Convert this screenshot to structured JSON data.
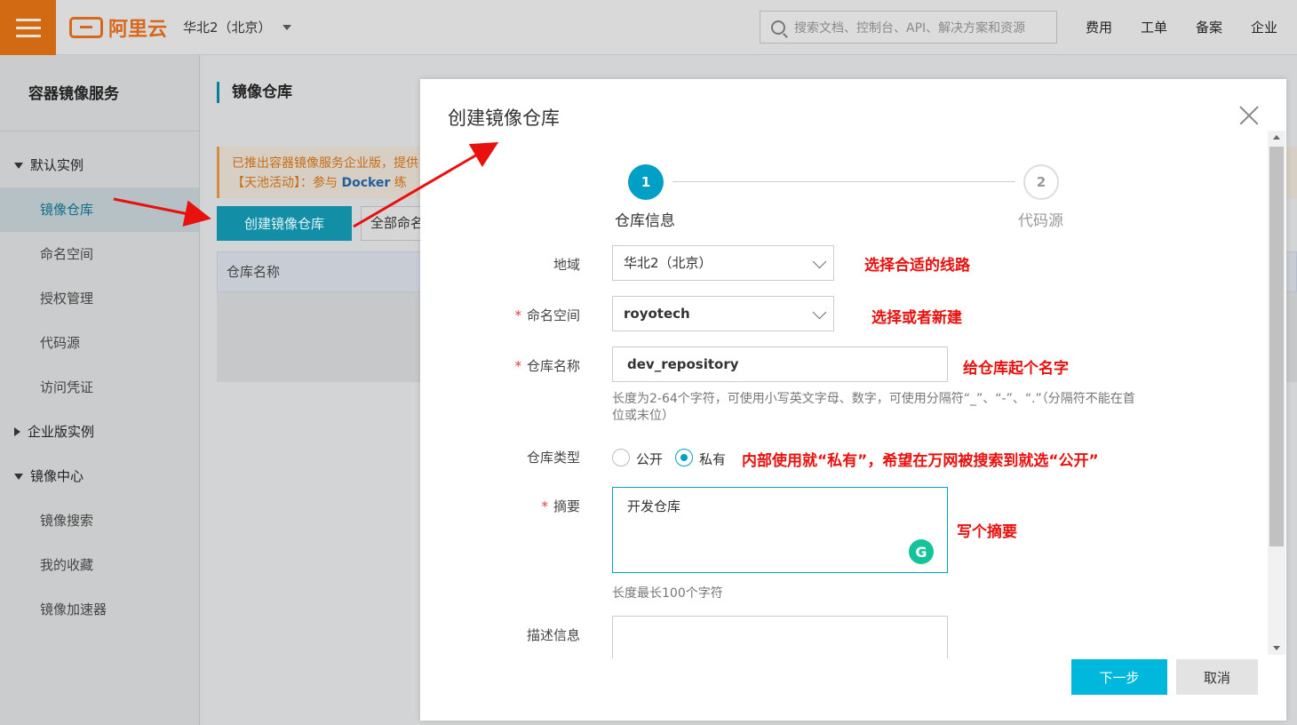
{
  "header": {
    "logo_text": "阿里云",
    "region": "华北2（北京）",
    "search_placeholder": "搜索文档、控制台、API、解决方案和资源",
    "links": [
      "费用",
      "工单",
      "备案",
      "企业"
    ]
  },
  "sidebar": {
    "title": "容器镜像服务",
    "group_default": "默认实例",
    "default_items": [
      "镜像仓库",
      "命名空间",
      "授权管理",
      "代码源",
      "访问凭证"
    ],
    "group_enterprise": "企业版实例",
    "group_center": "镜像中心",
    "center_items": [
      "镜像搜索",
      "我的收藏",
      "镜像加速器"
    ]
  },
  "main": {
    "page_title": "镜像仓库",
    "notice_line1": "已推出容器镜像服务企业版，提供",
    "notice_line2_prefix": "【天池活动】：参与",
    "notice_line2_link": "Docker",
    "notice_line2_suffix": "练",
    "create_button": "创建镜像仓库",
    "namespace_filter": "全部命名",
    "table_col_name": "仓库名称"
  },
  "modal": {
    "title": "创建镜像仓库",
    "steps": [
      {
        "number": "1",
        "label": "仓库信息"
      },
      {
        "number": "2",
        "label": "代码源"
      }
    ],
    "region_label": "地域",
    "region_value": "华北2（北京）",
    "region_annotation": "选择合适的线路",
    "namespace_label": "命名空间",
    "namespace_value": "royotech",
    "namespace_annotation": "选择或者新建",
    "repo_name_label": "仓库名称",
    "repo_name_value": "dev_repository",
    "repo_name_annotation": "给仓库起个名字",
    "repo_name_hint_line1": "长度为2-64个字符，可使用小写英文字母、数字，可使用分隔符“_”、“-”、“.”（分隔符不能在首",
    "repo_name_hint_line2": "位或末位）",
    "repo_type_label": "仓库类型",
    "repo_type_public": "公开",
    "repo_type_private": "私有",
    "repo_type_selected": "私有",
    "repo_type_annotation": "内部使用就“私有”，希望在万网被搜索到就选“公开”",
    "summary_label": "摘要",
    "summary_value": "开发仓库",
    "summary_annotation": "写个摘要",
    "summary_hint": "长度最长100个字符",
    "description_label": "描述信息",
    "next_button": "下一步",
    "cancel_button": "取消"
  },
  "colors": {
    "brand_orange": "#d26a14",
    "primary_teal": "#00a0c6",
    "annotation_red": "#e8110e"
  },
  "icons": [
    "menu-icon",
    "aliyun-logo-icon",
    "chevron-down-icon",
    "search-icon",
    "close-icon",
    "grammarly-icon"
  ]
}
